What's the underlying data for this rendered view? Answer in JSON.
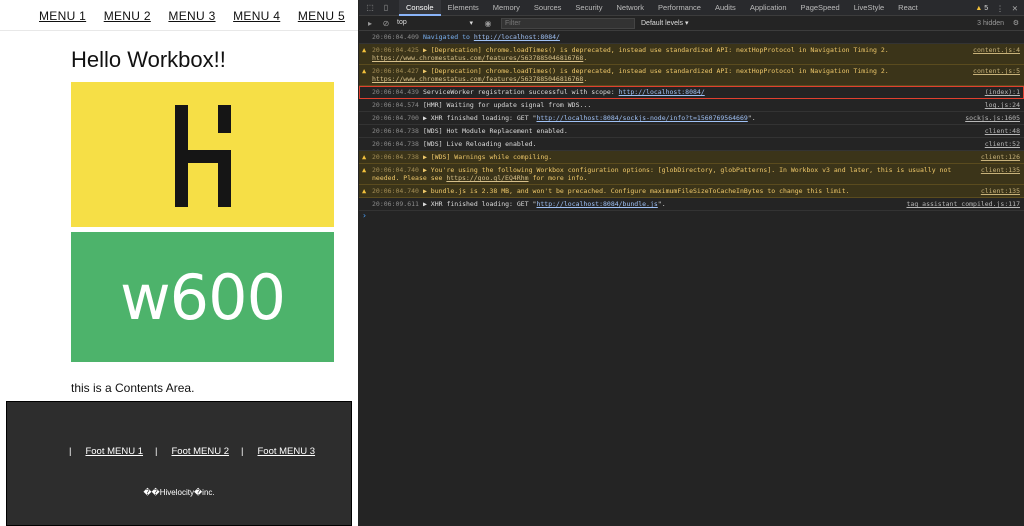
{
  "page": {
    "menu": [
      "MENU 1",
      "MENU 2",
      "MENU 3",
      "MENU 4",
      "MENU 5"
    ],
    "heading": "Hello Workbox!!",
    "image2_text": "w600",
    "contents_text": "this is a Contents Area.",
    "footer": {
      "separator": "|",
      "menu": [
        "Foot MENU 1",
        "Foot MENU 2",
        "Foot MENU 3"
      ],
      "copyright": "��Hivelocity�inc."
    },
    "colors": {
      "logo_bg": "#f6df46",
      "w600_bg": "#4db36b",
      "footer_bg": "#2d2d2d"
    }
  },
  "devtools": {
    "tabs": [
      "Console",
      "Elements",
      "Memory",
      "Sources",
      "Security",
      "Network",
      "Performance",
      "Audits",
      "Application",
      "PageSpeed",
      "LiveStyle",
      "React"
    ],
    "active_tab": "Console",
    "warning_count": "5",
    "context": "top",
    "filter_placeholder": "Filter",
    "levels": "Default levels ▾",
    "hidden": "3 hidden",
    "messages": [
      {
        "ts": "20:06:04.409",
        "text": "Navigated to ",
        "link": "http://localhost:8084/",
        "src": "",
        "level": "info"
      },
      {
        "ts": "20:06:04.425",
        "text": "▶ [Deprecation] chrome.loadTimes() is deprecated, instead use standardized API: nextHopProtocol in Navigation Timing 2. ",
        "link": "https://www.chromestatus.com/features/5637885046816768",
        "tail": ".",
        "src": "content.js:4",
        "level": "warning"
      },
      {
        "ts": "20:06:04.427",
        "text": "▶ [Deprecation] chrome.loadTimes() is deprecated, instead use standardized API: nextHopProtocol in Navigation Timing 2. ",
        "link": "https://www.chromestatus.com/features/5637885046816768",
        "tail": ".",
        "src": "content.js:5",
        "level": "warning"
      },
      {
        "ts": "20:06:04.439",
        "text": "ServiceWorker registration successful with scope:  ",
        "link": "http://localhost:8084/",
        "src": "(index):1",
        "level": "log",
        "highlight": true
      },
      {
        "ts": "20:06:04.574",
        "text": "[HMR] Waiting for update signal from WDS...",
        "src": "log.js:24",
        "level": "log"
      },
      {
        "ts": "20:06:04.700",
        "text": "▶ XHR finished loading: GET \"",
        "link": "http://localhost:8084/sockjs-node/info?t=1560769564669",
        "tail": "\".",
        "src": "sockjs.js:1605",
        "level": "log"
      },
      {
        "ts": "20:06:04.738",
        "text": "[WDS] Hot Module Replacement enabled.",
        "src": "client:48",
        "level": "log"
      },
      {
        "ts": "20:06:04.738",
        "text": "[WDS] Live Reloading enabled.",
        "src": "client:52",
        "level": "log"
      },
      {
        "ts": "20:06:04.738",
        "text": "▶ [WDS] Warnings while compiling.",
        "src": "client:126",
        "level": "warning"
      },
      {
        "ts": "20:06:04.740",
        "text": "▶ You're using the following Workbox configuration options: [globDirectory, globPatterns]. In Workbox v3 and later, this is usually not needed. Please see ",
        "link": "https://goo.gl/EQ4Rhm",
        "tail": " for more info.",
        "src": "client:135",
        "level": "warning"
      },
      {
        "ts": "20:06:04.740",
        "text": "▶ bundle.js is 2.38 MB, and won't be precached. Configure maximumFileSizeToCacheInBytes to change this limit.",
        "src": "client:135",
        "level": "warning"
      },
      {
        "ts": "20:06:09.611",
        "text": "▶ XHR finished loading: GET \"",
        "link": "http://localhost:8084/bundle.js",
        "tail": "\".",
        "src": "tag_assistant_compiled.js:117",
        "level": "log"
      }
    ],
    "prompt": "›"
  }
}
